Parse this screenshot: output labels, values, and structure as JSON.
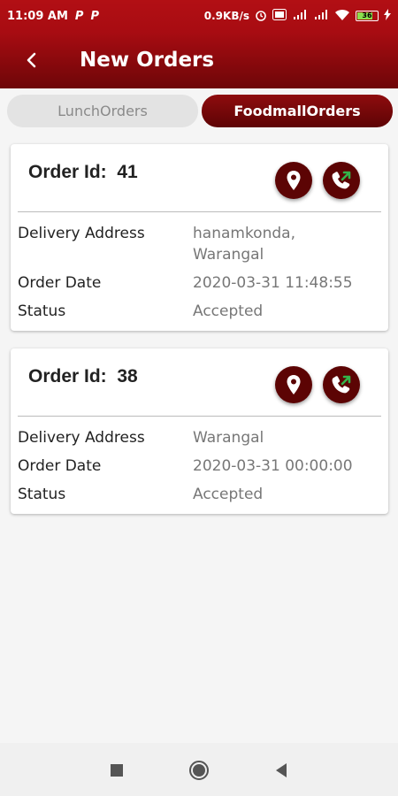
{
  "status_bar": {
    "time": "11:09 AM",
    "notif_icons": [
      "P",
      "P"
    ],
    "speed": "0.9KB/s",
    "battery": "36"
  },
  "app_bar": {
    "title": "New Orders",
    "back_icon": "back-arrow-icon"
  },
  "tabs": [
    {
      "label": "LunchOrders",
      "active": false
    },
    {
      "label": "FoodmallOrders",
      "active": true
    }
  ],
  "orders": [
    {
      "id_label": "Order Id:",
      "id_value": "41",
      "address_label": "Delivery Address",
      "address_line1": "hanamkonda,",
      "address_line2": "Warangal",
      "date_label": "Order Date",
      "date_value": "2020-03-31 11:48:55",
      "status_label": "Status",
      "status_value": "Accepted"
    },
    {
      "id_label": "Order Id:",
      "id_value": "38",
      "address_label": "Delivery Address",
      "address_line1": "Warangal",
      "address_line2": "",
      "date_label": "Order Date",
      "date_value": "2020-03-31 00:00:00",
      "status_label": "Status",
      "status_value": "Accepted"
    }
  ],
  "colors": {
    "primary": "#a80c12",
    "dark_primary": "#5c0404",
    "call_accent": "#33b44a"
  }
}
